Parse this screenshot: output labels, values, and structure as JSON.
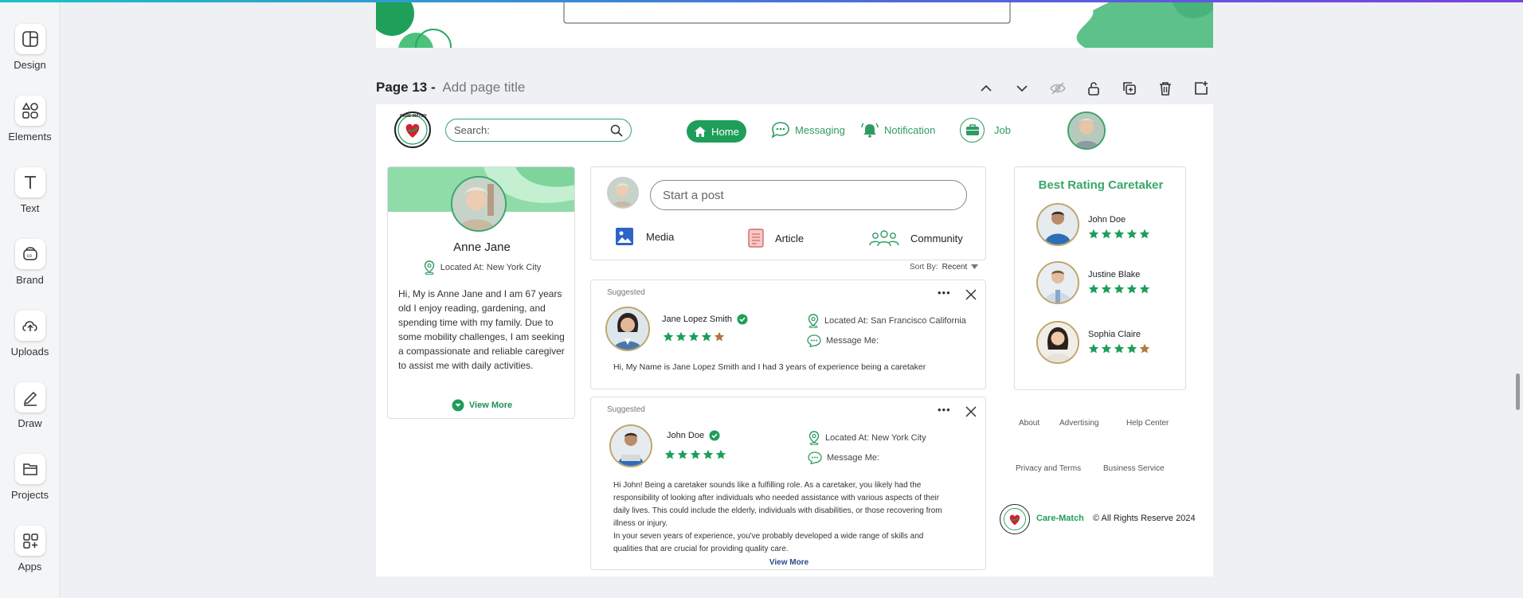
{
  "sidebar": {
    "items": [
      {
        "label": "Design",
        "icon": "layout-icon"
      },
      {
        "label": "Elements",
        "icon": "shapes-icon"
      },
      {
        "label": "Text",
        "icon": "text-icon"
      },
      {
        "label": "Brand",
        "icon": "brand-icon"
      },
      {
        "label": "Uploads",
        "icon": "upload-cloud-icon"
      },
      {
        "label": "Draw",
        "icon": "pen-icon"
      },
      {
        "label": "Projects",
        "icon": "folder-icon"
      },
      {
        "label": "Apps",
        "icon": "apps-grid-icon"
      }
    ]
  },
  "page_header": {
    "title": "Page 13 -",
    "add_title_placeholder": "Add page title"
  },
  "design": {
    "logo_text": "CARE-MATCH",
    "search_placeholder": "Search:",
    "nav": {
      "home": "Home",
      "messaging": "Messaging",
      "notification": "Notification",
      "job": "Job"
    },
    "profile": {
      "name": "Anne Jane",
      "location": "Located At: New York City",
      "bio": "Hi, My is Anne Jane and I am 67 years old I enjoy reading, gardening, and spending time with my family. Due to some mobility challenges, I am seeking a compassionate and reliable caregiver to assist me with daily activities.",
      "view_more": "View More"
    },
    "composer": {
      "placeholder": "Start a  post",
      "media": "Media",
      "article": "Article",
      "community": "Community"
    },
    "sort": {
      "label": "Sort By:",
      "value": "Recent"
    },
    "posts": [
      {
        "tag": "Suggested",
        "name": "Jane Lopez Smith",
        "rating": 4,
        "location": "Located At: San Francisco California",
        "message": "Message Me:",
        "text": "Hi, My Name is Jane Lopez Smith and I had 3 years of experience being a caretaker"
      },
      {
        "tag": "Suggested",
        "name": "John Doe",
        "rating": 5,
        "location": "Located At: New York City",
        "message": "Message Me:",
        "text1": "Hi John! Being a caretaker sounds like a fulfilling role. As a caretaker, you likely had the responsibility of looking after individuals who needed assistance with various aspects of their daily lives. This could include the elderly, individuals with disabilities, or those recovering from illness or injury.",
        "text2": "In your seven years of experience, you've probably developed a wide range of skills and qualities that are crucial for providing quality care.",
        "view_more": "View More"
      }
    ],
    "best_rating": {
      "title": "Best Rating Caretaker",
      "items": [
        {
          "name": "John Doe",
          "rating": 5
        },
        {
          "name": "Justine Blake",
          "rating": 5
        },
        {
          "name": "Sophia Claire",
          "rating": 4
        }
      ]
    },
    "footer": {
      "links": [
        "About",
        "Advertising",
        "Help Center",
        "Privacy and Terms",
        "Business Service"
      ],
      "brand": "Care-Match",
      "copyright": "© All Rights Reserve 2024"
    }
  },
  "colors": {
    "accent": "#1f9e59",
    "star_filled": "#1f9e59",
    "star_bronze": "#b0773e",
    "profile_banner": "#8fdca8"
  }
}
